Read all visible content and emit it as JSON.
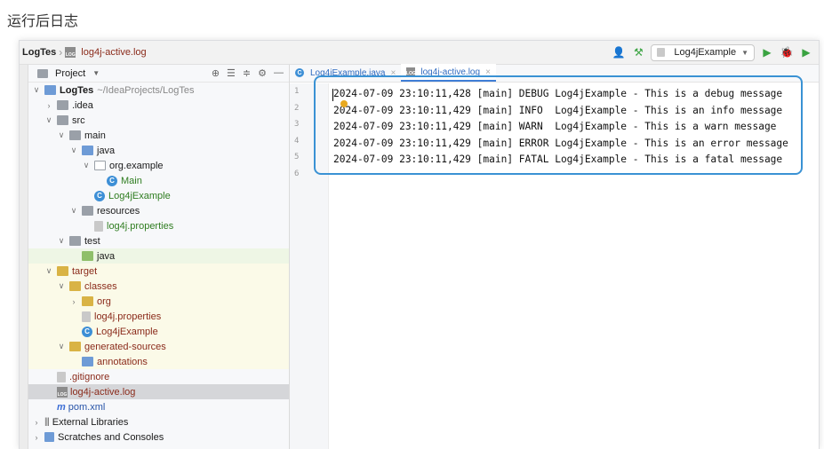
{
  "caption": "运行后日志",
  "navbar": {
    "project_crumb": "LogTes",
    "file_crumb": "log4j-active.log",
    "run_config": "Log4jExample"
  },
  "project_panel": {
    "title": "Project",
    "tree": [
      {
        "label": "LogTes",
        "suffix": "~/IdeaProjects/LogTes"
      },
      {
        "label": ".idea"
      },
      {
        "label": "src"
      },
      {
        "label": "main"
      },
      {
        "label": "java"
      },
      {
        "label": "org.example"
      },
      {
        "label": "Main"
      },
      {
        "label": "Log4jExample"
      },
      {
        "label": "resources"
      },
      {
        "label": "log4j.properties"
      },
      {
        "label": "test"
      },
      {
        "label": "java"
      },
      {
        "label": "target"
      },
      {
        "label": "classes"
      },
      {
        "label": "org"
      },
      {
        "label": "log4j.properties"
      },
      {
        "label": "Log4jExample"
      },
      {
        "label": "generated-sources"
      },
      {
        "label": "annotations"
      },
      {
        "label": ".gitignore"
      },
      {
        "label": "log4j-active.log"
      },
      {
        "label": "pom.xml"
      },
      {
        "label": "External Libraries"
      },
      {
        "label": "Scratches and Consoles"
      }
    ]
  },
  "editor": {
    "tabs": [
      {
        "label": "Log4jExample.java"
      },
      {
        "label": "log4j-active.log"
      }
    ],
    "line_numbers": [
      "1",
      "2",
      "3",
      "4",
      "5",
      "6"
    ],
    "lines": [
      "2024-07-09 23:10:11,428 [main] DEBUG Log4jExample - This is a debug message",
      "2024-07-09 23:10:11,429 [main] INFO  Log4jExample - This is an info message",
      "2024-07-09 23:10:11,429 [main] WARN  Log4jExample - This is a warn message",
      "2024-07-09 23:10:11,429 [main] ERROR Log4jExample - This is an error message",
      "2024-07-09 23:10:11,429 [main] FATAL Log4jExample - This is a fatal message"
    ]
  },
  "colors": {
    "accent": "#3a92d4",
    "run_green": "#3aa341",
    "tab_blue": "#2f6ac0"
  }
}
